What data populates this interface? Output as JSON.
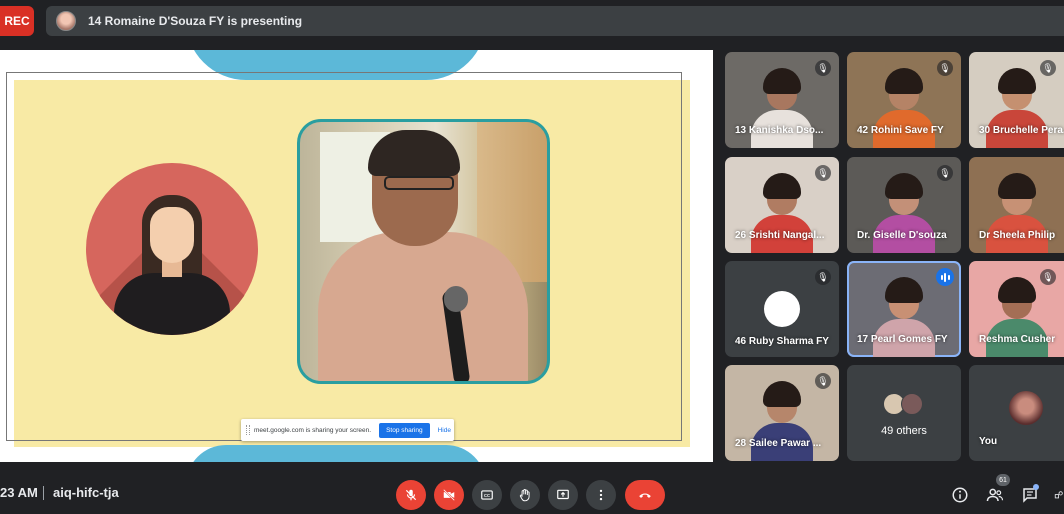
{
  "top_bar": {
    "rec_label": "REC",
    "presenting_text": "14 Romaine D'Souza FY is presenting"
  },
  "share_notice": {
    "message": "meet.google.com is sharing your screen.",
    "stop_label": "Stop sharing",
    "hide_label": "Hide"
  },
  "participants": [
    {
      "name": "13 Kanishka Dso...",
      "muted": true
    },
    {
      "name": "42 Rohini Save FY",
      "muted": true
    },
    {
      "name": "30 Bruchelle Pera...",
      "muted": true
    },
    {
      "name": "26 Srishti Nangal...",
      "muted": true
    },
    {
      "name": "Dr. Giselle D'souza",
      "muted": true
    },
    {
      "name": "Dr Sheela Philip",
      "muted": false
    },
    {
      "name": "46 Ruby Sharma FY",
      "muted": true
    },
    {
      "name": "17 Pearl Gomes FY",
      "muted": false,
      "speaking": true
    },
    {
      "name": "Reshma Cusher",
      "muted": true
    },
    {
      "name": "28 Sailee Pawar ...",
      "muted": true
    }
  ],
  "others": {
    "label": "49 others"
  },
  "self": {
    "label": "You"
  },
  "bottom_bar": {
    "time": "23 AM",
    "meeting_code": "aiq-hifc-tja",
    "people_count": "61"
  },
  "icons": {
    "mute": "mic-off-icon",
    "camera": "camera-off-icon",
    "captions": "captions-icon",
    "hand": "raise-hand-icon",
    "present": "present-screen-icon",
    "more": "more-options-icon",
    "end": "end-call-icon",
    "info": "info-icon",
    "people": "people-icon",
    "chat": "chat-icon",
    "activities": "activities-icon"
  },
  "colors": {
    "rec": "#d93025",
    "end_call": "#ea4335",
    "speaking": "#1a73e8",
    "slide_bg": "#f8eaa5",
    "photo_border": "#2a9ea0"
  }
}
